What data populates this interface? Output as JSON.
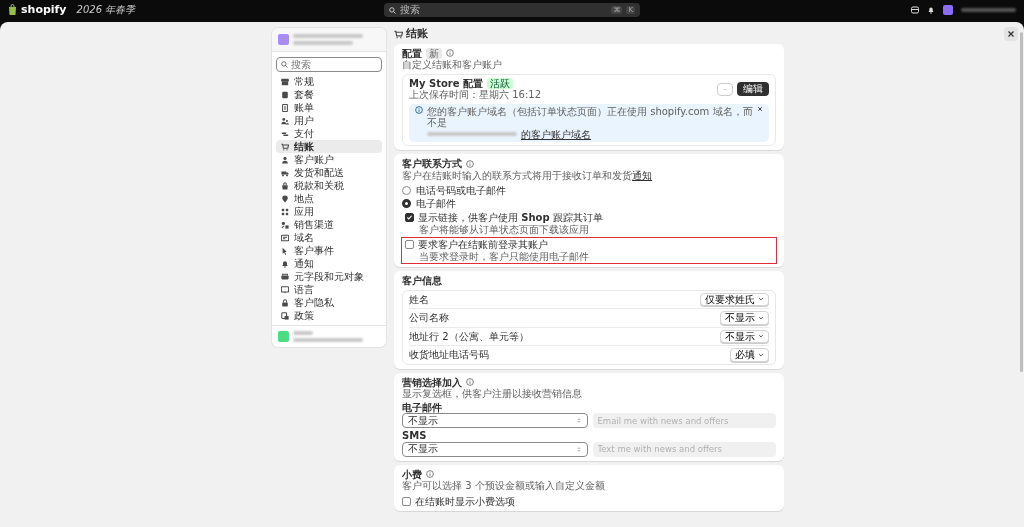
{
  "topbar": {
    "logo": "shopify",
    "edition": "2026 年春季",
    "search": {
      "placeholder": "搜索",
      "keys": [
        "⌘",
        "K"
      ]
    }
  },
  "sidebar": {
    "search": {
      "placeholder": "搜索"
    },
    "items": [
      {
        "label": "常规",
        "selected": false
      },
      {
        "label": "套餐",
        "selected": false
      },
      {
        "label": "账单",
        "selected": false
      },
      {
        "label": "用户",
        "selected": false
      },
      {
        "label": "支付",
        "selected": false
      },
      {
        "label": "结账",
        "selected": true
      },
      {
        "label": "客户账户",
        "selected": false
      },
      {
        "label": "发货和配送",
        "selected": false
      },
      {
        "label": "税款和关税",
        "selected": false
      },
      {
        "label": "地点",
        "selected": false
      },
      {
        "label": "应用",
        "selected": false
      },
      {
        "label": "销售渠道",
        "selected": false
      },
      {
        "label": "域名",
        "selected": false
      },
      {
        "label": "客户事件",
        "selected": false
      },
      {
        "label": "通知",
        "selected": false
      },
      {
        "label": "元字段和元对象",
        "selected": false
      },
      {
        "label": "语言",
        "selected": false
      },
      {
        "label": "客户隐私",
        "selected": false
      },
      {
        "label": "政策",
        "selected": false
      }
    ]
  },
  "page_title": "结账",
  "configuration": {
    "title": "配置",
    "badge": "新",
    "description": "自定义结账和客户账户",
    "store": {
      "name": "My Store 配置",
      "status": "活跃",
      "saved": "上次保存时间：星期六 16:12",
      "edit_button": "编辑"
    },
    "banner": {
      "text": "您的客户账户域名（包括订单状态页面）正在使用 shopify.com 域名，而不是",
      "link": "的客户账户域名"
    }
  },
  "contact": {
    "title": "客户联系方式",
    "description": "客户在结账时输入的联系方式将用于接收订单和发货",
    "description_link": "通知",
    "radios": [
      {
        "label": "电话号码或电子邮件",
        "selected": false
      },
      {
        "label": "电子邮件",
        "selected": true
      }
    ],
    "checkboxes": [
      {
        "label": "显示链接，供客户使用 **Shop** 跟踪其订单",
        "hint": "客户将能够从订单状态页面下载该应用",
        "checked": true,
        "highlighted": false
      },
      {
        "label": "要求客户在结账前登录其账户",
        "hint": "当要求登录时，客户只能使用电子邮件",
        "checked": false,
        "highlighted": true
      }
    ]
  },
  "customer_info": {
    "title": "客户信息",
    "rows": [
      {
        "label": "姓名",
        "value": "仅要求姓氏"
      },
      {
        "label": "公司名称",
        "value": "不显示"
      },
      {
        "label": "地址行 2（公寓、单元等）",
        "value": "不显示"
      },
      {
        "label": "收货地址电话号码",
        "value": "必填"
      }
    ]
  },
  "marketing": {
    "title": "营销选择加入",
    "description": "显示复选框，供客户注册以接收营销信息",
    "fields": [
      {
        "label": "电子邮件",
        "value": "不显示",
        "placeholder": "Email me with news and offers"
      },
      {
        "label": "SMS",
        "value": "不显示",
        "placeholder": "Text me with news and offers"
      }
    ]
  },
  "tips": {
    "title": "小费",
    "description": "客户可以选择 3 个预设金额或输入自定义金额",
    "checkbox": {
      "label": "在结账时显示小费选项",
      "checked": false
    }
  }
}
